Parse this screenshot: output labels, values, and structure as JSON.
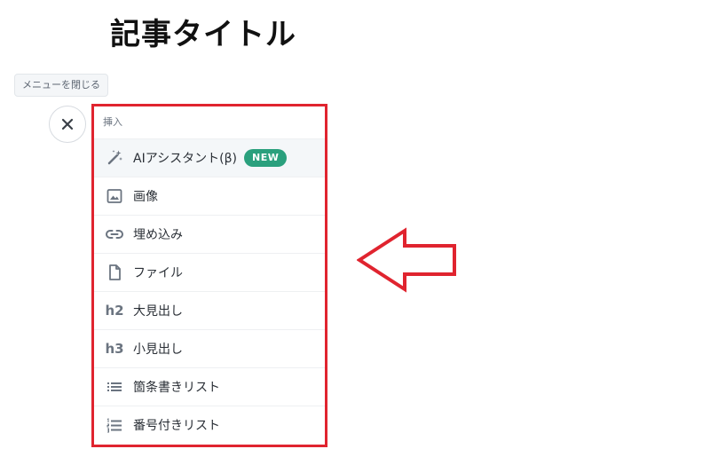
{
  "article": {
    "title": "記事タイトル"
  },
  "toolbar": {
    "close_menu_label": "メニューを閉じる"
  },
  "menu": {
    "section_label": "挿入",
    "items": [
      {
        "label": "AIアシスタント(β)",
        "icon": "magic-wand-icon",
        "badge": "NEW"
      },
      {
        "label": "画像",
        "icon": "image-icon"
      },
      {
        "label": "埋め込み",
        "icon": "link-icon"
      },
      {
        "label": "ファイル",
        "icon": "file-icon"
      },
      {
        "label": "大見出し",
        "icon": "h2",
        "icon_text": "h2"
      },
      {
        "label": "小見出し",
        "icon": "h3",
        "icon_text": "h3"
      },
      {
        "label": "箇条書きリスト",
        "icon": "bullet-list-icon"
      },
      {
        "label": "番号付きリスト",
        "icon": "numbered-list-icon"
      }
    ]
  },
  "colors": {
    "highlight_border": "#e0242f",
    "badge_bg": "#2aa07d",
    "icon_gray": "#6b7480"
  }
}
